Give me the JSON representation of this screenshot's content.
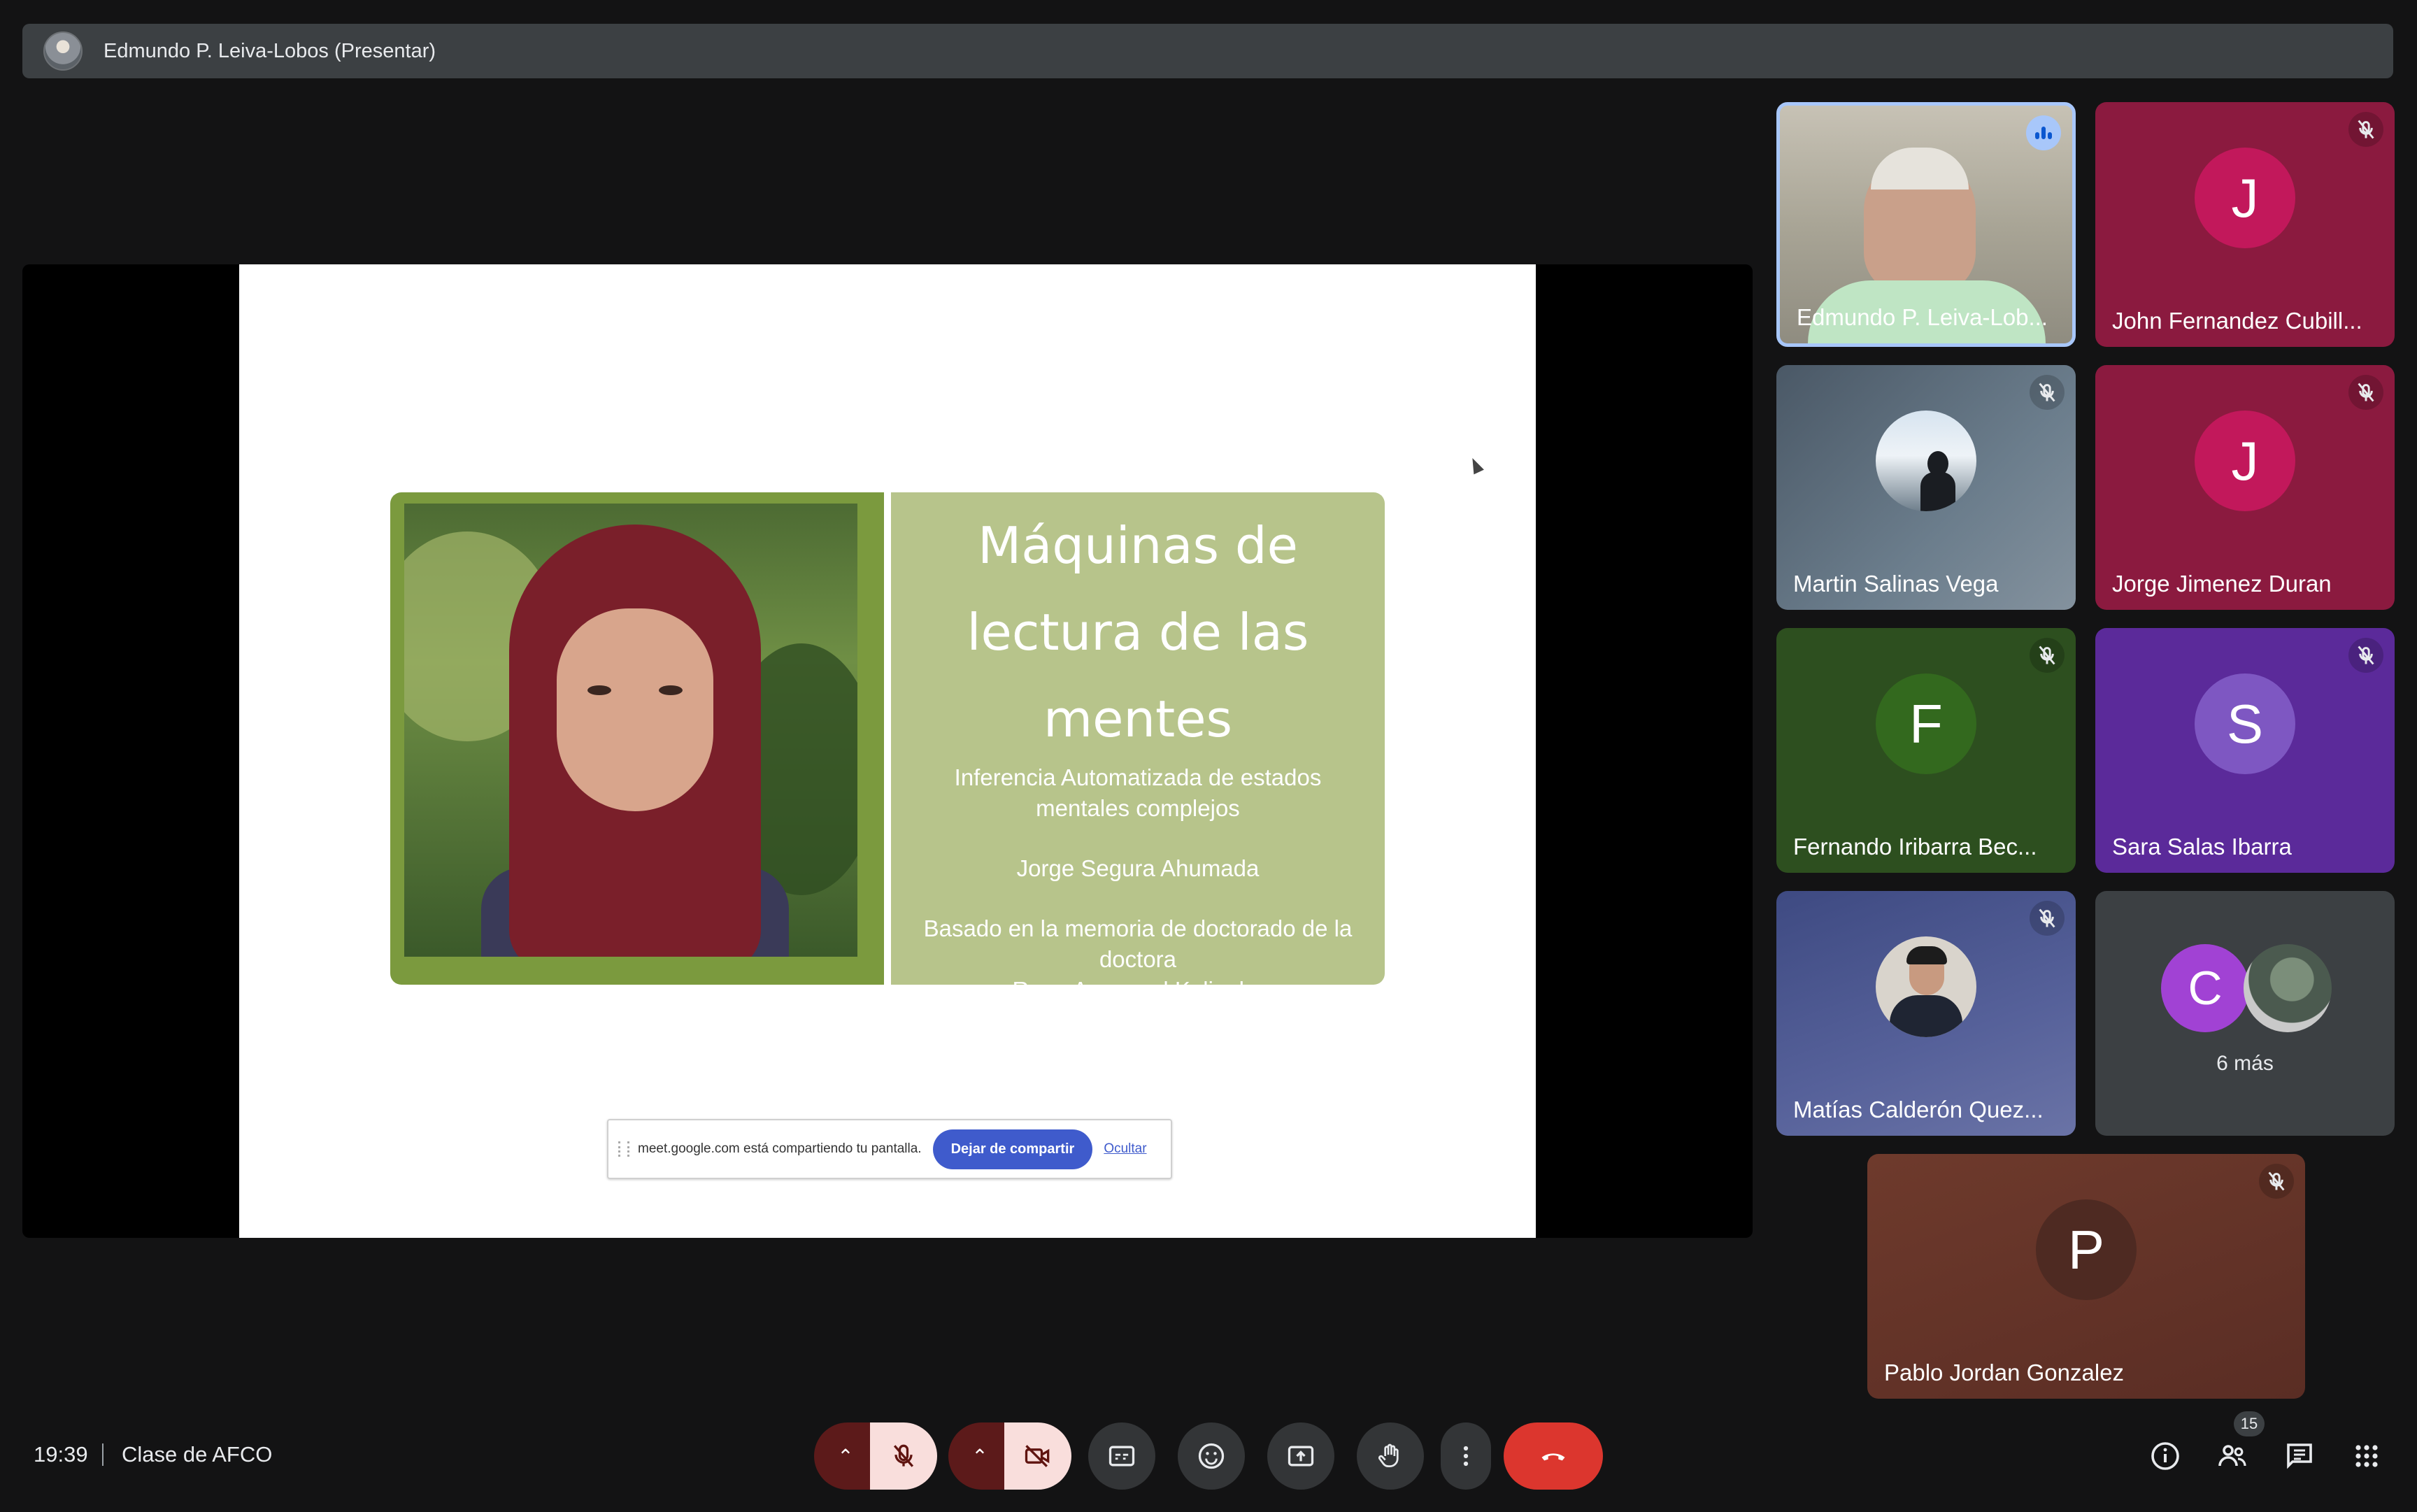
{
  "presenter_bar": {
    "label": "Edmundo P. Leiva-Lobos (Presentar)"
  },
  "slide": {
    "title_lines": [
      "Máquinas de",
      "lectura de las",
      "mentes"
    ],
    "subtitle": "Inferencia Automatizada de estados mentales complejos",
    "author": "Jorge Segura Ahumada",
    "based_on_1": "Basado en la memoria de doctorado de la doctora",
    "based_on_2": "Rana Ayman el Kaliouby",
    "colors": {
      "photo_frame": "#7b9a3e",
      "text_panel": "#b7c48b"
    }
  },
  "share_banner": {
    "text": "meet.google.com está compartiendo tu pantalla.",
    "stop_label": "Dejar de compartir",
    "hide_label": "Ocultar"
  },
  "participants": [
    {
      "name": "Edmundo P. Leiva-Lob...",
      "type": "video",
      "speaking": true
    },
    {
      "name": "John Fernandez Cubill...",
      "initial": "J",
      "muted": true,
      "bg": "#8b1a3f",
      "avatar": "#c2185b"
    },
    {
      "name": "Martin Salinas Vega",
      "type": "photo",
      "muted": true
    },
    {
      "name": "Jorge Jimenez Duran",
      "initial": "J",
      "muted": true,
      "bg": "#8b1a3f",
      "avatar": "#c2185b"
    },
    {
      "name": "Fernando Iribarra Bec...",
      "initial": "F",
      "muted": true,
      "bg": "#2d4f1f",
      "avatar": "#33691e"
    },
    {
      "name": "Sara Salas Ibarra",
      "initial": "S",
      "muted": true,
      "bg": "#5b2a9a",
      "avatar": "#7e57c2"
    },
    {
      "name": "Matías Calderón Quez...",
      "type": "photo",
      "muted": true
    },
    {
      "name": "Pablo Jordan Gonzalez",
      "initial": "P",
      "muted": true,
      "bg": "#5c2e24",
      "avatar": "#4e2a22"
    }
  ],
  "more_tile": {
    "initial": "C",
    "label": "6 más"
  },
  "bottom_bar": {
    "time": "19:39",
    "meeting": "Clase de AFCO",
    "participant_count": "15"
  },
  "icons": [
    "mic-off-icon",
    "camera-off-icon",
    "captions-icon",
    "emoji-icon",
    "present-icon",
    "raise-hand-icon",
    "more-options-icon",
    "leave-call-icon",
    "info-icon",
    "people-icon",
    "chat-icon",
    "apps-icon",
    "speaking-icon"
  ]
}
